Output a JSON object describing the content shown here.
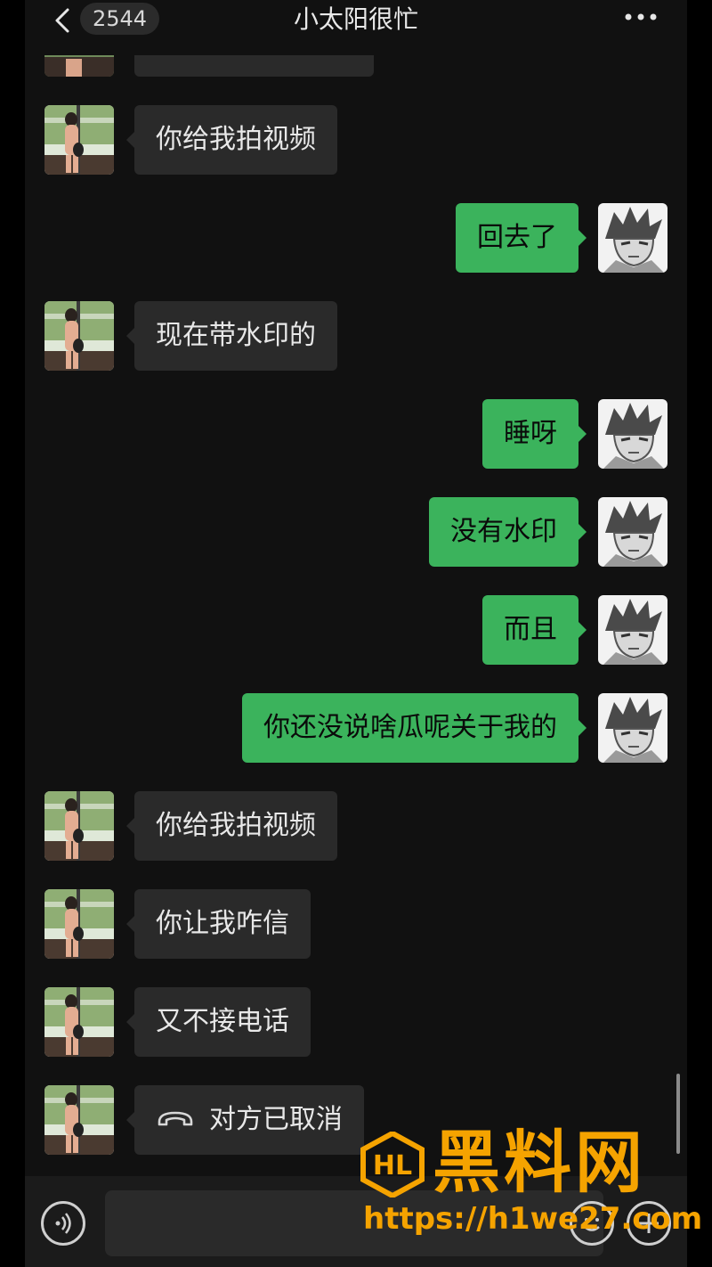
{
  "header": {
    "unread_count": "2544",
    "title": "小太阳很忙"
  },
  "messages": [
    {
      "side": "in",
      "text": "你给我拍视频"
    },
    {
      "side": "out",
      "text": "回去了"
    },
    {
      "side": "in",
      "text": "现在带水印的"
    },
    {
      "side": "out",
      "text": "睡呀"
    },
    {
      "side": "out",
      "text": "没有水印"
    },
    {
      "side": "out",
      "text": "而且"
    },
    {
      "side": "out",
      "text": "你还没说啥瓜呢关于我的"
    },
    {
      "side": "in",
      "text": "你给我拍视频"
    },
    {
      "side": "in",
      "text": "你让我咋信"
    },
    {
      "side": "in",
      "text": "又不接电话"
    },
    {
      "side": "in",
      "text": "对方已取消",
      "icon": "phone-hangup-icon"
    }
  ],
  "watermark": {
    "name": "黑料网",
    "url": "https://h1we27.com"
  },
  "colors": {
    "background": "#111111",
    "incoming_bubble": "#2a2a2a",
    "outgoing_bubble": "#3bb35c",
    "watermark": "#f5a300"
  }
}
